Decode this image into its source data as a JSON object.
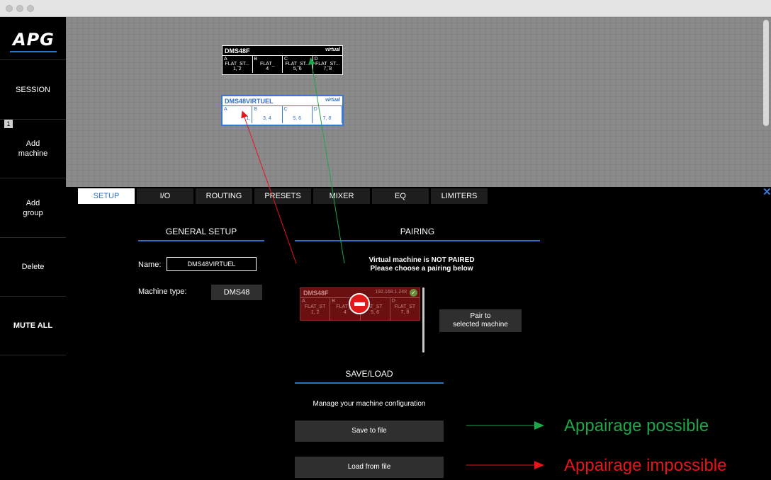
{
  "sidebar": {
    "logo": "APG",
    "items": [
      {
        "label": "SESSION"
      },
      {
        "label": "Add\nmachine",
        "badge": "1"
      },
      {
        "label": "Add\ngroup"
      },
      {
        "label": "Delete"
      },
      {
        "label": "MUTE ALL"
      }
    ]
  },
  "canvas": {
    "machines": [
      {
        "name": "DMS48F",
        "tag": "virtual",
        "channels": [
          {
            "letter": "A",
            "preset": "FLAT_ST...",
            "outputs": "1, 2"
          },
          {
            "letter": "B",
            "preset": "FLAT_",
            "outputs": "4"
          },
          {
            "letter": "C",
            "preset": "FLAT_ST...",
            "outputs": "5, 6"
          },
          {
            "letter": "D",
            "preset": "FLAT_ST...",
            "outputs": "7, 8"
          }
        ]
      },
      {
        "name": "DMS48VIRTUEL",
        "tag": "virtual",
        "channels": [
          {
            "letter": "A",
            "preset": "",
            "outputs": "1,"
          },
          {
            "letter": "B",
            "preset": "",
            "outputs": "3, 4"
          },
          {
            "letter": "C",
            "preset": "",
            "outputs": "5, 6"
          },
          {
            "letter": "D",
            "preset": "",
            "outputs": "7, 8"
          }
        ]
      }
    ]
  },
  "tabs": [
    "SETUP",
    "I/O",
    "ROUTING",
    "PRESETS",
    "MIXER",
    "EQ",
    "LIMITERS"
  ],
  "active_tab": "SETUP",
  "general_setup": {
    "title": "GENERAL SETUP",
    "name_label": "Name:",
    "name_value": "DMS48VIRTUEL",
    "type_label": "Machine type:",
    "type_value": "DMS48"
  },
  "pairing": {
    "title": "PAIRING",
    "status_line1": "Virtual machine is NOT PAIRED",
    "status_line2": "Please choose a pairing below",
    "candidate": {
      "name": "DMS48F",
      "ip": "192.168.1.248",
      "channels": [
        {
          "letter": "A",
          "preset": "FLAT_ST",
          "outputs": "1, 2"
        },
        {
          "letter": "B",
          "preset": "FLAT_S",
          "outputs": "4"
        },
        {
          "letter": "C",
          "preset": "AT_ST",
          "outputs": "5, 6"
        },
        {
          "letter": "D",
          "preset": "FLAT_ST",
          "outputs": "7, 8"
        }
      ]
    },
    "pair_button": "Pair to\nselected machine"
  },
  "save_load": {
    "title": "SAVE/LOAD",
    "description": "Manage your machine configuration",
    "save_button": "Save to file",
    "load_button": "Load from file"
  },
  "annotations": {
    "possible": "Appairage possible",
    "impossible": "Appairage impossible",
    "green": "#1fa54a",
    "red": "#e8141b"
  },
  "colors": {
    "accent": "#2e6fc8",
    "canvas": "#8a8a8a",
    "pair_card": "#6b1010"
  }
}
